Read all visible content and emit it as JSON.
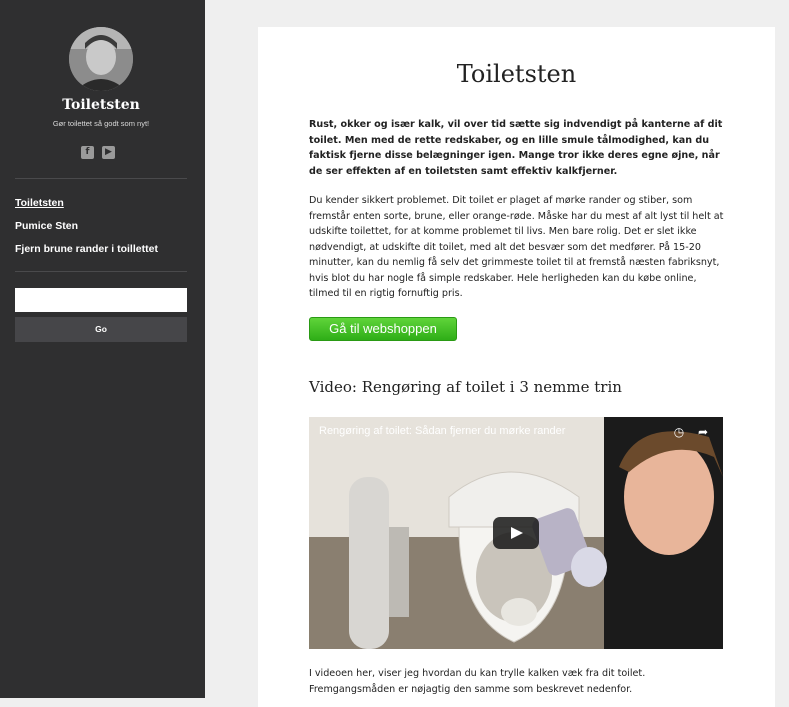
{
  "sidebar": {
    "site_title": "Toiletsten",
    "tagline": "Gør toilettet så godt som nyt!",
    "social": [
      "facebook-icon",
      "youtube-icon"
    ],
    "nav": [
      {
        "label": "Toiletsten",
        "active": true
      },
      {
        "label": "Pumice Sten",
        "active": false
      },
      {
        "label": "Fjern brune rander i toillettet",
        "active": false
      }
    ],
    "search": {
      "value": "",
      "placeholder": "",
      "button_label": "Go"
    }
  },
  "main": {
    "title": "Toiletsten",
    "lead": "Rust, okker og især kalk, vil over tid sætte sig indvendigt på kanterne af dit toilet. Men med de rette redskaber, og en lille smule tålmodighed, kan du faktisk fjerne disse belægninger igen. Mange tror ikke deres egne øjne, når de ser effekten af en toiletsten samt effektiv kalkfjerner.",
    "body1": "Du kender sikkert problemet. Dit toilet er plaget af mørke rander og stiber, som fremstår enten sorte, brune, eller orange-røde. Måske har du mest af alt lyst til helt at udskifte toilettet, for at komme problemet til livs. Men bare rolig. Det er slet ikke nødvendigt, at udskifte dit toilet, med alt det besvær som det medfører. På 15-20 minutter, kan du nemlig få selv det grimmeste toilet til at fremstå næsten fabriksnyt, hvis blot du har nogle få simple redskaber. Hele herligheden kan du købe online, tilmed til en rigtig fornuftig pris.",
    "shop_button": "Gå til webshoppen",
    "video_heading": "Video: Rengøring af toilet i 3 nemme trin",
    "video": {
      "title": "Rengøring af toilet: Sådan fjerner du mørke rander",
      "controls": [
        "clock-icon",
        "share-icon"
      ]
    },
    "body2": "I videoen her, viser jeg hvordan du kan trylle kalken væk fra dit toilet. Fremgangsmåden er nøjagtig den samme som beskrevet nedenfor."
  },
  "colors": {
    "sidebar_bg": "#2f2f30",
    "page_bg": "#efefef",
    "shop_button": "#3cbf23"
  }
}
